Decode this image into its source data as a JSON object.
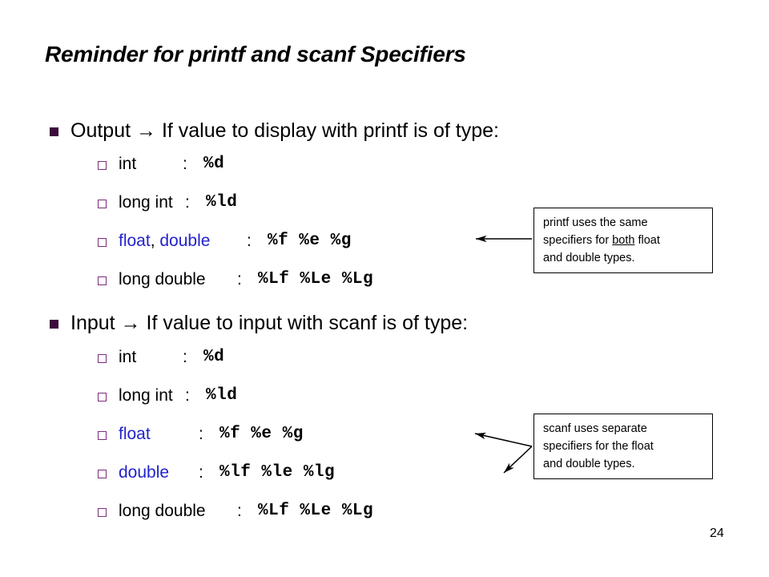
{
  "slide": {
    "title": "Reminder for printf and scanf Specifiers",
    "page_number": "24",
    "colors": {
      "background": "#ffffff",
      "text": "#000000",
      "bullet_level1": "#3A0B3A",
      "bullet_level2": "#7B2D7B",
      "type_highlight": "#2222CC"
    }
  },
  "sections": [
    {
      "heading": "Output → If value to display with printf is of type:",
      "rows": [
        {
          "type": "int",
          "colon": ":",
          "spec": "%d",
          "highlight": "none"
        },
        {
          "type": "long int",
          "colon": ":",
          "spec": "%ld",
          "highlight": "none"
        },
        {
          "type": "float, double",
          "colon": ":",
          "spec": "%f  %e  %g",
          "highlight": "float-double"
        },
        {
          "type": "long double",
          "colon": ":",
          "spec": "%Lf %Le %Lg",
          "highlight": "none"
        }
      ]
    },
    {
      "heading": "Input → If value to input with scanf is of type:",
      "rows": [
        {
          "type": "int",
          "colon": ":",
          "spec": "%d",
          "highlight": "none"
        },
        {
          "type": "long int",
          "colon": ":",
          "spec": "%ld",
          "highlight": "none"
        },
        {
          "type": "float",
          "colon": ":",
          "spec": "%f  %e  %g",
          "highlight": "all"
        },
        {
          "type": "double",
          "colon": ":",
          "spec": "%lf %le %lg",
          "highlight": "all"
        },
        {
          "type": "long double",
          "colon": ":",
          "spec": "%Lf %Le %Lg",
          "highlight": "none"
        }
      ]
    }
  ],
  "callouts": [
    {
      "id": "printf-note",
      "lines_html": [
        "printf uses the same",
        "specifiers for <u>both</u> float",
        "and double types."
      ],
      "lines_text": [
        "printf uses the same",
        "specifiers for both float",
        "and double types.",
        "printf uses the same specifiers for both float and double types."
      ]
    },
    {
      "id": "scanf-note",
      "lines_html": [
        "scanf uses separate",
        "specifiers for the float",
        "and double types."
      ],
      "lines_text": [
        "scanf uses separate",
        "specifiers for the float",
        "and double types.",
        "scanf uses separate specifiers for the float and double types."
      ]
    }
  ]
}
